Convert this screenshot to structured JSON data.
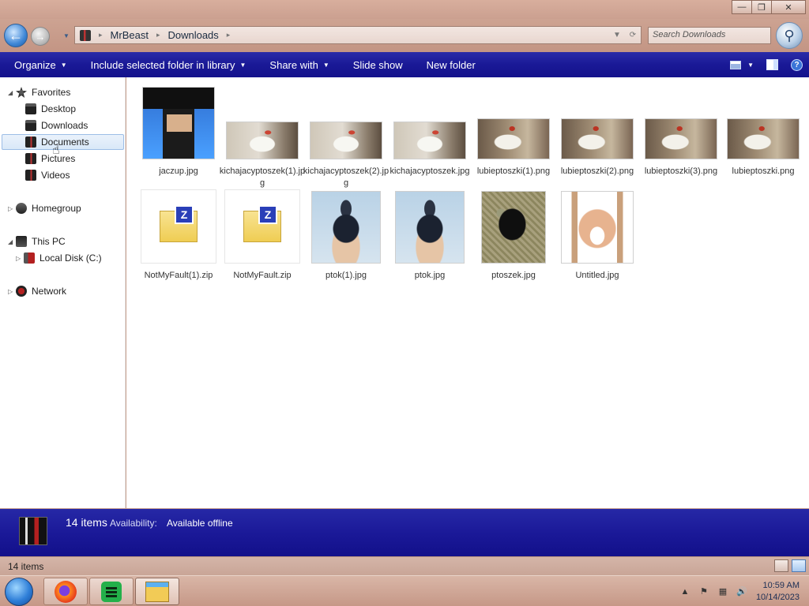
{
  "window": {
    "controls": {
      "minimize": "—",
      "maximize": "❐",
      "close": "✕"
    }
  },
  "nav": {
    "back_glyph": "←",
    "forward_glyph": "→",
    "breadcrumb": [
      "MrBeast",
      "Downloads"
    ],
    "search_placeholder": "Search Downloads"
  },
  "commandbar": {
    "organize": "Organize",
    "include_library": "Include selected folder in library",
    "share_with": "Share with",
    "slide_show": "Slide show",
    "new_folder": "New folder"
  },
  "sidebar": {
    "favorites": "Favorites",
    "desktop": "Desktop",
    "downloads": "Downloads",
    "documents": "Documents",
    "pictures": "Pictures",
    "videos": "Videos",
    "homegroup": "Homegroup",
    "this_pc": "This PC",
    "local_disk": "Local Disk (C:)",
    "network": "Network"
  },
  "files": [
    {
      "name": "jaczup.jpg"
    },
    {
      "name": "kichajacyptoszek(1).jpg"
    },
    {
      "name": "kichajacyptoszek(2).jpg"
    },
    {
      "name": "kichajacyptoszek.jpg"
    },
    {
      "name": "lubieptoszki(1).png"
    },
    {
      "name": "lubieptoszki(2).png"
    },
    {
      "name": "lubieptoszki(3).png"
    },
    {
      "name": "lubieptoszki.png"
    },
    {
      "name": "NotMyFault(1).zip"
    },
    {
      "name": "NotMyFault.zip"
    },
    {
      "name": "ptok(1).jpg"
    },
    {
      "name": "ptok.jpg"
    },
    {
      "name": "ptoszek.jpg"
    },
    {
      "name": "Untitled.jpg"
    }
  ],
  "details": {
    "count": "14 items",
    "availability_label": "Availability:",
    "availability_value": "Available offline"
  },
  "status": {
    "items": "14 items"
  },
  "taskbar": {
    "time": "10:59 AM",
    "date": "10/14/2023"
  },
  "colors": {
    "accent": "#1a1996",
    "chrome": "#c9a08f",
    "selection": "#d9e8f8"
  }
}
